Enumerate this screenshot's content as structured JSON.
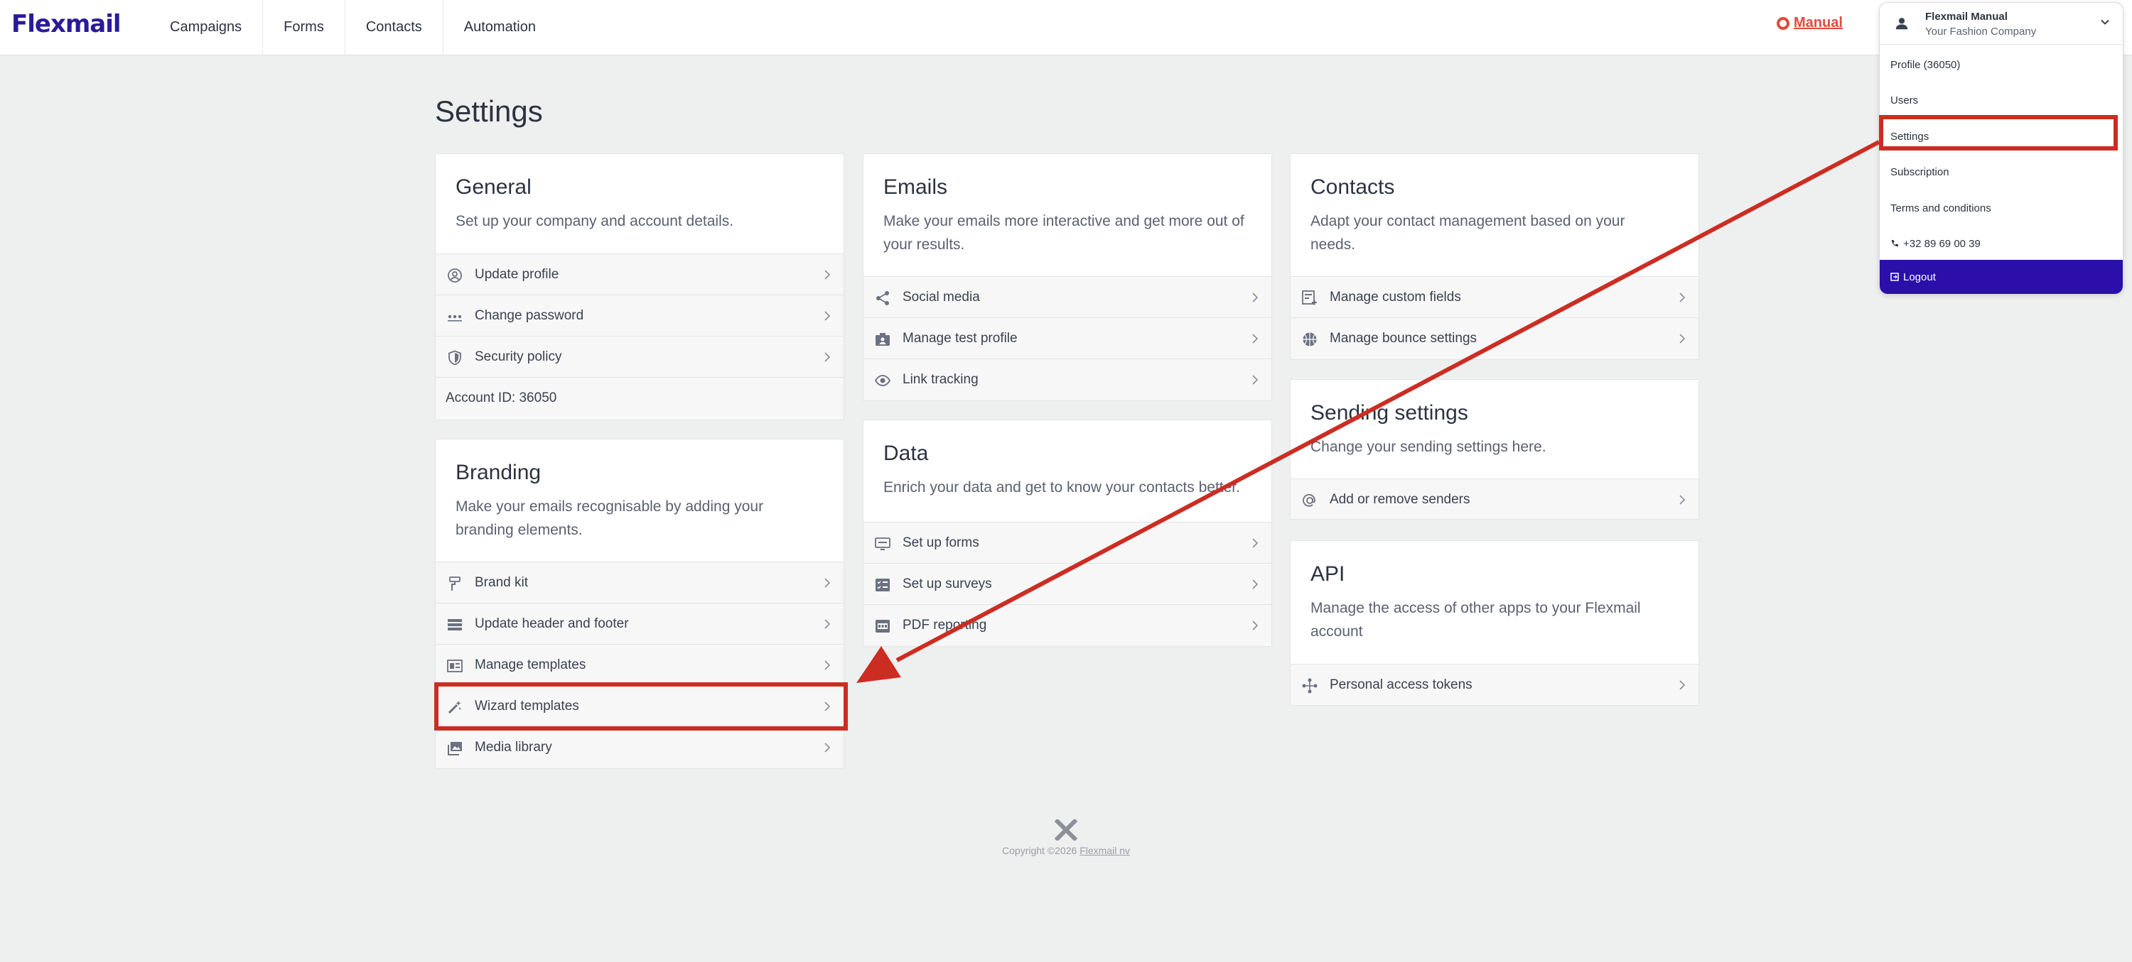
{
  "brand": {
    "logo_text": "Flexmail"
  },
  "nav": {
    "items": [
      "Campaigns",
      "Forms",
      "Contacts",
      "Automation"
    ]
  },
  "manual_link": "Manual",
  "account_menu": {
    "user_name": "Flexmail Manual",
    "company": "Your Fashion Company",
    "items": [
      "Profile (36050)",
      "Users",
      "Settings",
      "Subscription",
      "Terms and conditions",
      "+32 89 69 00 39"
    ],
    "logout": "Logout"
  },
  "page": {
    "title": "Settings"
  },
  "cards": {
    "general": {
      "title": "General",
      "description": "Set up your company and account details.",
      "rows": [
        "Update profile",
        "Change password",
        "Security policy"
      ],
      "account_id": "Account ID: 36050"
    },
    "branding": {
      "title": "Branding",
      "description": "Make your emails recognisable by adding your branding elements.",
      "rows": [
        "Brand kit",
        "Update header and footer",
        "Manage templates",
        "Wizard templates",
        "Media library"
      ]
    },
    "emails": {
      "title": "Emails",
      "description": "Make your emails more interactive and get more out of your results.",
      "rows": [
        "Social media",
        "Manage test profile",
        "Link tracking"
      ]
    },
    "data": {
      "title": "Data",
      "description": "Enrich your data and get to know your contacts better.",
      "rows": [
        "Set up forms",
        "Set up surveys",
        "PDF reporting"
      ]
    },
    "contacts": {
      "title": "Contacts",
      "description": "Adapt your contact management based on your needs.",
      "rows": [
        "Manage custom fields",
        "Manage bounce settings"
      ]
    },
    "sending": {
      "title": "Sending settings",
      "description": "Change your sending settings here.",
      "rows": [
        "Add or remove senders"
      ]
    },
    "api": {
      "title": "API",
      "description": "Manage the access of other apps to your Flexmail account",
      "rows": [
        "Personal access tokens"
      ]
    }
  },
  "footer": {
    "copyright": "Copyright ©2026",
    "company_link": "Flexmail nv"
  },
  "colors": {
    "brand": "#2a1a9a",
    "logout_bg": "#2b0fa8",
    "manual": "#e24a3b",
    "highlight": "#cc2d22"
  }
}
